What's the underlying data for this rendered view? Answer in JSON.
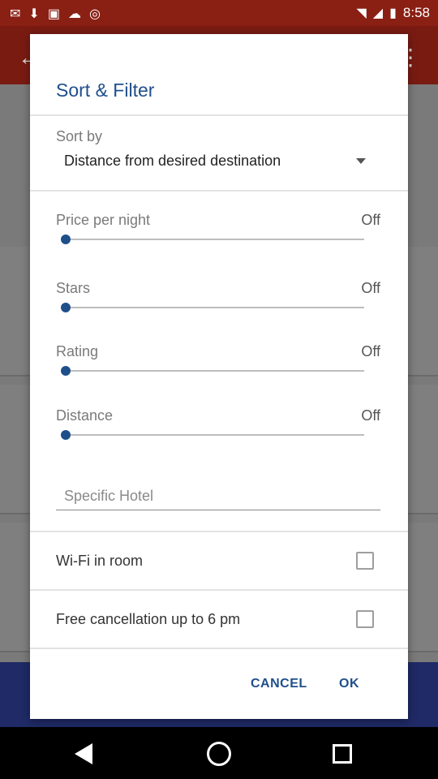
{
  "status_bar": {
    "time": "8:58",
    "icons": [
      "mail-icon",
      "download-icon",
      "image-icon",
      "cloud-icon",
      "instagram-icon",
      "wifi-icon",
      "signal-icon",
      "battery-icon"
    ]
  },
  "dialog": {
    "title": "Sort & Filter",
    "sort": {
      "label": "Sort by",
      "selected": "Distance from desired destination"
    },
    "filters": [
      {
        "label": "Price per night",
        "value": "Off",
        "level": 0
      },
      {
        "label": "Stars",
        "value": "Off",
        "level": 0
      },
      {
        "label": "Rating",
        "value": "Off",
        "level": 0
      },
      {
        "label": "Distance",
        "value": "Off",
        "level": 0
      }
    ],
    "hotel_search": {
      "placeholder": "Specific Hotel",
      "value": ""
    },
    "checkboxes": [
      {
        "label": "Wi-Fi in room",
        "checked": false
      },
      {
        "label": "Free cancellation up to 6 pm",
        "checked": false
      }
    ],
    "buttons": {
      "cancel": "CANCEL",
      "ok": "OK"
    }
  },
  "colors": {
    "accent": "#1f4f8b",
    "app_bar": "#c62828"
  }
}
